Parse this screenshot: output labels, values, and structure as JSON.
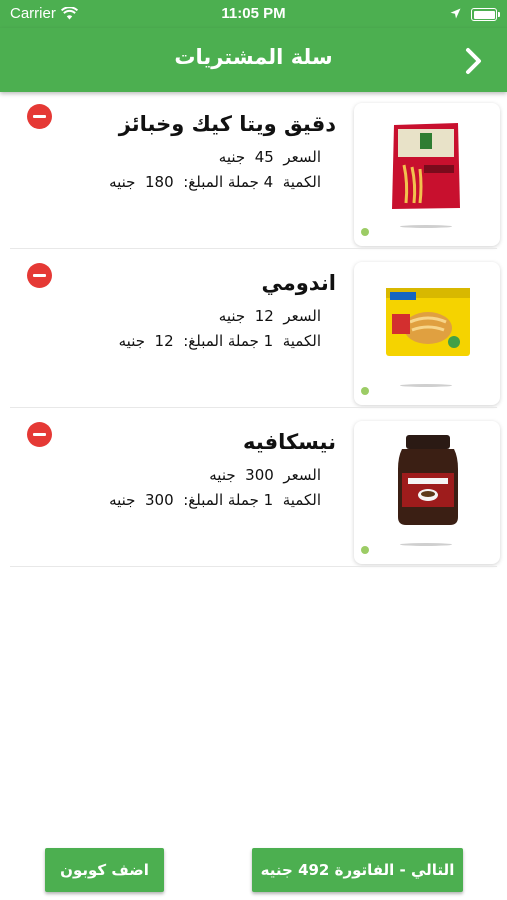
{
  "status_bar": {
    "carrier": "Carrier",
    "time": "11:05 PM"
  },
  "nav": {
    "title": "سلة المشتريات",
    "back_icon": "chevron-right-icon"
  },
  "labels": {
    "price": "السعر",
    "quantity": "الكمية",
    "total": "جملة المبلغ:",
    "currency": "جنيه"
  },
  "items": [
    {
      "name": "دقيق ويتا كيك وخبائز",
      "price": "45",
      "quantity": "4",
      "total": "180",
      "image": "flour-bag-icon"
    },
    {
      "name": "اندومي",
      "price": "12",
      "quantity": "1",
      "total": "12",
      "image": "noodles-pack-icon"
    },
    {
      "name": "نيسكافيه",
      "price": "300",
      "quantity": "1",
      "total": "300",
      "image": "coffee-jar-icon"
    }
  ],
  "buttons": {
    "add_coupon": "اضف كوبون",
    "next": "التالي - الفاتورة 492 جنيه"
  },
  "colors": {
    "primary": "#4caf50",
    "remove": "#e53935"
  }
}
